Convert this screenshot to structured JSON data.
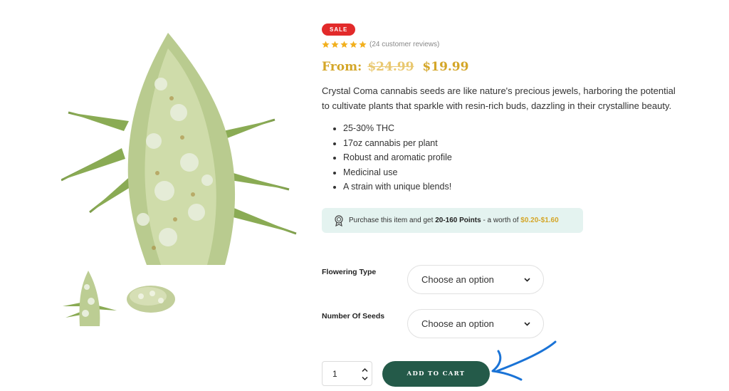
{
  "product": {
    "sale_badge": "SALE",
    "rating": {
      "stars": 5,
      "reviews_text": "(24 customer reviews)"
    },
    "price": {
      "prefix": "From:",
      "old": "$24.99",
      "new": "$19.99"
    },
    "description": "Crystal Coma cannabis seeds are like nature's precious jewels, harboring the potential to cultivate plants that sparkle with resin-rich buds, dazzling in their crystalline beauty.",
    "features": [
      "25-30% THC",
      "17oz cannabis per plant",
      "Robust and aromatic profile",
      "Medicinal use",
      "A strain with unique blends!"
    ]
  },
  "points": {
    "lead": "Purchase this item and get",
    "amount": "20-160 Points",
    "mid": "- a worth of",
    "low": "$0.20",
    "dash": "-",
    "high": "$1.60",
    "icon": "medal-icon"
  },
  "variations": {
    "flowering": {
      "label": "Flowering Type",
      "value": "Choose an option"
    },
    "seeds": {
      "label": "Number Of Seeds",
      "value": "Choose an option"
    }
  },
  "cart": {
    "quantity": "1",
    "button_label": "ADD TO CART"
  },
  "colors": {
    "sale": "#e22a2a",
    "price_gold": "#d4a628",
    "button": "#245a49",
    "points_bg": "#e4f3f0",
    "annotation_arrow": "#1a73d6"
  }
}
